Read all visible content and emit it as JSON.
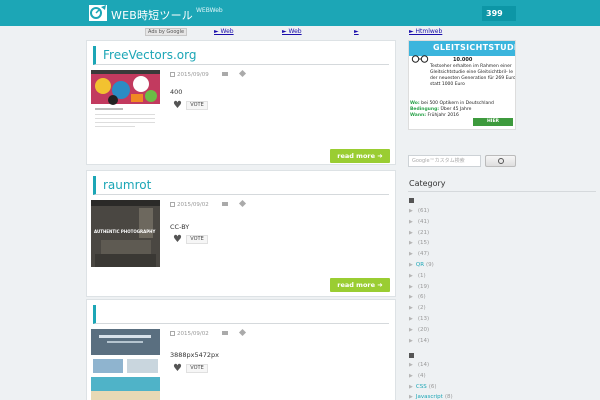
{
  "header": {
    "logo_text": "WEB時短ツール",
    "logo_sub": "WEBWeb",
    "count": "399"
  },
  "adbar": {
    "ads_label": "Ads by Google",
    "links": [
      "► Web",
      "► Web",
      "►"
    ]
  },
  "posts": [
    {
      "title": "FreeVectors.org",
      "date": "2015/09/09",
      "text": "400",
      "vote_label": "VOTE",
      "read_more": "read more ➜"
    },
    {
      "title": "raumrot",
      "date": "2015/09/02",
      "text": "CC-BY",
      "vote_label": "VOTE",
      "read_more": "read more ➜",
      "thumb_caption": "AUTHENTIC PHOTOGRAPHY"
    },
    {
      "title": "",
      "date": "2015/09/02",
      "text": "3888px5472px",
      "vote_label": "VOTE"
    }
  ],
  "sidebar": {
    "ad_link": "► Htmlweb",
    "ad": {
      "brand": "GLEITSICHTSTUDIE",
      "price_line": "10.000",
      "body": "Testseher erhalten im Rahmen einer Gleitsichtstudie eine Gleitsichtbril- le der neuesten Generation für 269 Euro statt 1000 Euro",
      "where_key": "Wo:",
      "where_val": "bei 500 Optikern in Deutschland",
      "cond_key": "Bedingung:",
      "cond_val": "Über 45 Jahre",
      "when_key": "Wann:",
      "when_val": "Frühjahr 2016",
      "button": "HIER ANMELDEN"
    },
    "search_placeholder": "Google™カスタム検索",
    "category_title": "Category",
    "group1": [
      {
        "name": "",
        "count": "(61)"
      },
      {
        "name": "",
        "count": "(41)"
      },
      {
        "name": "",
        "count": "(21)"
      },
      {
        "name": "",
        "count": "(15)"
      },
      {
        "name": "",
        "count": "(47)"
      },
      {
        "name": "QR",
        "count": "(9)"
      },
      {
        "name": "",
        "count": "(1)"
      },
      {
        "name": "",
        "count": "(19)"
      },
      {
        "name": "",
        "count": "(6)"
      },
      {
        "name": "",
        "count": "(2)"
      },
      {
        "name": "",
        "count": "(13)"
      },
      {
        "name": "",
        "count": "(20)"
      },
      {
        "name": "",
        "count": "(14)"
      }
    ],
    "group2": [
      {
        "name": "",
        "count": "(14)"
      },
      {
        "name": "",
        "count": "(4)"
      },
      {
        "name": "CSS",
        "count": "(6)"
      },
      {
        "name": "Javascript",
        "count": "(8)"
      }
    ]
  }
}
